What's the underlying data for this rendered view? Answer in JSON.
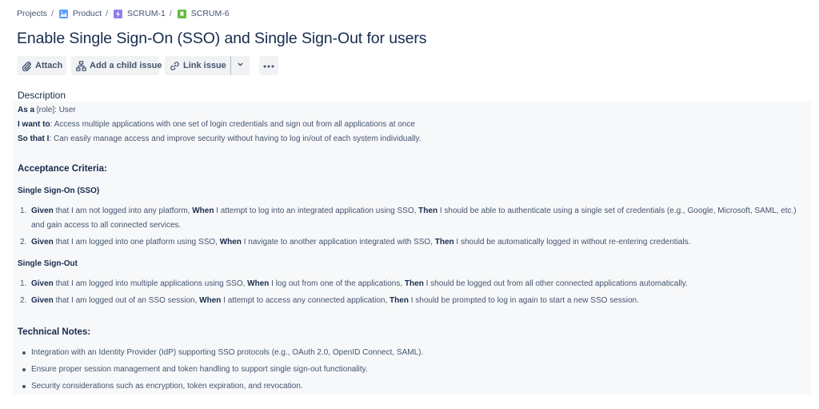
{
  "breadcrumb": [
    {
      "label": "Projects",
      "icon": null
    },
    {
      "label": "Product",
      "icon": "project-avatar-icon",
      "icon_color": "#579DFF"
    },
    {
      "label": "SCRUM-1",
      "icon": "epic-icon",
      "icon_color": "#8F7EE7"
    },
    {
      "label": "SCRUM-6",
      "icon": "story-icon",
      "icon_color": "#4BCE97"
    }
  ],
  "breadcrumb_separator": "/",
  "issue": {
    "title": "Enable Single Sign-On (SSO) and Single Sign-Out for users"
  },
  "toolbar": {
    "attach_label": "Attach",
    "add_child_label": "Add a child issue",
    "link_issue_label": "Link issue",
    "more_label": "•••"
  },
  "description": {
    "label": "Description",
    "user_story": [
      {
        "key": "As a",
        "rest": " [role]: User"
      },
      {
        "key": "I want to",
        "rest": ": Access multiple applications with one set of login credentials and sign out from all applications at once"
      },
      {
        "key": "So that I",
        "rest": ": Can easily manage access and improve security without having to log in/out of each system individually."
      }
    ],
    "acceptance_heading": "Acceptance Criteria:",
    "sso_heading": "Single Sign-On (SSO)",
    "sso_items": [
      {
        "num": "1.",
        "given": "Given",
        "given_text": " that I am not logged into any platform, ",
        "when": "When",
        "when_text": " I attempt to log into an integrated application using SSO, ",
        "then": "Then",
        "then_text": " I should be able to authenticate using a single set of credentials (e.g., Google, Microsoft, SAML, etc.) and gain access to all connected services."
      },
      {
        "num": "2.",
        "given": "Given",
        "given_text": " that I am logged into one platform using SSO, ",
        "when": "When",
        "when_text": " I navigate to another application integrated with SSO, ",
        "then": "Then",
        "then_text": " I should be automatically logged in without re-entering credentials."
      }
    ],
    "slo_heading": "Single Sign-Out",
    "slo_items": [
      {
        "num": "1.",
        "given": "Given",
        "given_text": " that I am logged into multiple applications using SSO, ",
        "when": "When",
        "when_text": " I log out from one of the applications, ",
        "then": "Then",
        "then_text": " I should be logged out from all other connected applications automatically."
      },
      {
        "num": "2.",
        "given": "Given",
        "given_text": " that I am logged out of an SSO session, ",
        "when": "When",
        "when_text": " I attempt to access any connected application, ",
        "then": "Then",
        "then_text": " I should be prompted to log in again to start a new SSO session."
      }
    ],
    "technical_heading": "Technical Notes:",
    "technical_notes": [
      "Integration with an Identity Provider (IdP) supporting SSO protocols (e.g., OAuth 2.0, OpenID Connect, SAML).",
      "Ensure proper session management and token handling to support single sign-out functionality.",
      "Security considerations such as encryption, token expiration, and revocation."
    ]
  }
}
